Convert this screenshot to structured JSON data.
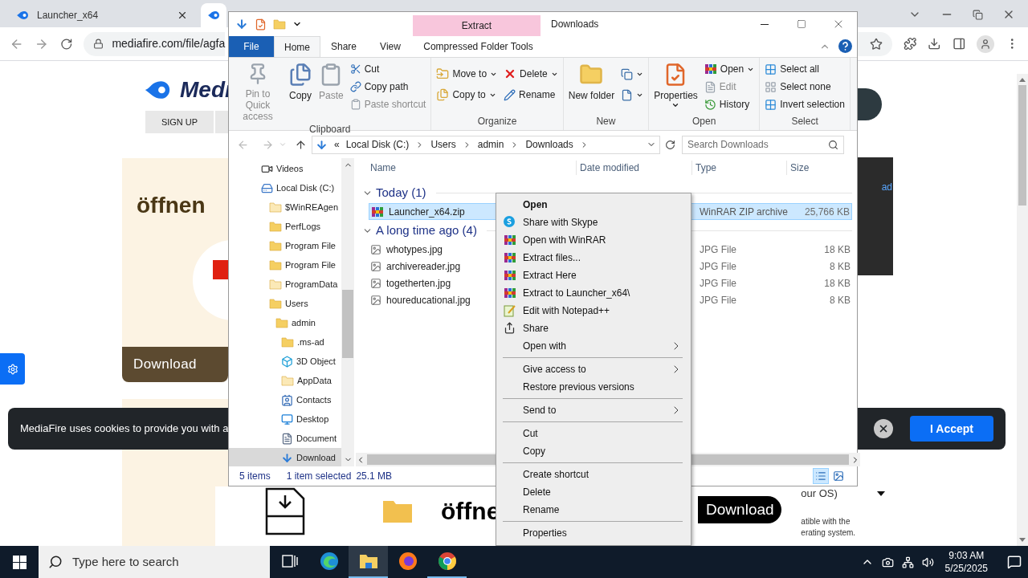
{
  "browser": {
    "tabs": [
      {
        "title": "Launcher_x64",
        "selected": false
      }
    ],
    "url": "mediafire.com/file/agfa",
    "page": {
      "logo_text": "Medi",
      "sign_up": "SIGN UP",
      "ad_heading": "öffnen",
      "ad_button": "Download",
      "cookie_text": "MediaFire uses cookies to provide you with a",
      "accept_button": "I Accept",
      "side_link": "ad",
      "bottom_heading": "öffne",
      "bottom_button": "Download",
      "os_select": "our OS)",
      "compat_lines": [
        "atible with the",
        "erating system."
      ]
    }
  },
  "explorer": {
    "title": "Downloads",
    "context_tab": "Extract",
    "ribbon_tabs": [
      {
        "label": "File",
        "kind": "file",
        "selected": false
      },
      {
        "label": "Home",
        "kind": "tab",
        "selected": true
      },
      {
        "label": "Share",
        "kind": "tab",
        "selected": false
      },
      {
        "label": "View",
        "kind": "tab",
        "selected": false
      },
      {
        "label": "Compressed Folder Tools",
        "kind": "contextual",
        "selected": false
      }
    ],
    "ribbon_groups": [
      {
        "title": "Clipboard",
        "columns": [
          {
            "kind": "large",
            "items": [
              {
                "label": "Pin to Quick access",
                "disabled": true,
                "dropdown": false
              }
            ]
          },
          {
            "kind": "large",
            "items": [
              {
                "label": "Copy",
                "disabled": false,
                "dropdown": false
              }
            ]
          },
          {
            "kind": "large",
            "items": [
              {
                "label": "Paste",
                "disabled": true,
                "dropdown": false
              }
            ]
          },
          {
            "kind": "small",
            "items": [
              {
                "label": "Cut",
                "disabled": false,
                "dropdown": false
              },
              {
                "label": "Copy path",
                "disabled": false,
                "dropdown": false
              },
              {
                "label": "Paste shortcut",
                "disabled": true,
                "dropdown": false
              }
            ]
          }
        ]
      },
      {
        "title": "Organize",
        "columns": [
          {
            "kind": "small",
            "items": [
              {
                "label": "Move to",
                "disabled": false,
                "dropdown": true
              },
              {
                "label": "Copy to",
                "disabled": false,
                "dropdown": true
              }
            ]
          },
          {
            "kind": "small",
            "items": [
              {
                "label": "Delete",
                "disabled": false,
                "dropdown": true
              },
              {
                "label": "Rename",
                "disabled": false,
                "dropdown": false
              }
            ]
          }
        ]
      },
      {
        "title": "New",
        "columns": [
          {
            "kind": "large",
            "items": [
              {
                "label": "New folder",
                "disabled": false,
                "dropdown": false
              }
            ]
          },
          {
            "kind": "small",
            "items": [
              {
                "disabled": false,
                "dropdown": true
              },
              {
                "disabled": false,
                "dropdown": true
              }
            ]
          }
        ]
      },
      {
        "title": "Open",
        "columns": [
          {
            "kind": "large",
            "items": [
              {
                "label": "Properties",
                "disabled": false,
                "dropdown": true
              }
            ]
          },
          {
            "kind": "small",
            "items": [
              {
                "label": "Open",
                "disabled": false,
                "dropdown": true
              },
              {
                "label": "Edit",
                "disabled": true,
                "dropdown": false
              },
              {
                "label": "History",
                "disabled": false,
                "dropdown": false
              }
            ]
          }
        ]
      },
      {
        "title": "Select",
        "columns": [
          {
            "kind": "small",
            "items": [
              {
                "label": "Select all",
                "disabled": false,
                "dropdown": false
              },
              {
                "label": "Select none",
                "disabled": false,
                "dropdown": false
              },
              {
                "label": "Invert selection",
                "disabled": false,
                "dropdown": false
              }
            ]
          }
        ]
      }
    ],
    "address": {
      "overflow": "«",
      "crumbs": [
        "Local Disk (C:)",
        "Users",
        "admin",
        "Downloads"
      ]
    },
    "search_placeholder": "Search Downloads",
    "nav": [
      {
        "label": "Videos",
        "kind": "videos",
        "selected": false
      },
      {
        "label": "Local Disk (C:)",
        "kind": "drive",
        "selected": false,
        "children": [
          {
            "label": "$WinREAgen",
            "kind": "folder-light",
            "selected": false
          },
          {
            "label": "PerfLogs",
            "kind": "folder",
            "selected": false
          },
          {
            "label": "Program File",
            "kind": "folder",
            "selected": false
          },
          {
            "label": "Program File",
            "kind": "folder",
            "selected": false
          },
          {
            "label": "ProgramData",
            "kind": "folder-light",
            "selected": false
          },
          {
            "label": "Users",
            "kind": "folder",
            "selected": false,
            "children": [
              {
                "label": "admin",
                "kind": "folder",
                "selected": false,
                "children": [
                  {
                    "label": ".ms-ad",
                    "kind": "folder",
                    "selected": false
                  },
                  {
                    "label": "3D Object",
                    "kind": "cube",
                    "selected": false
                  },
                  {
                    "label": "AppData",
                    "kind": "folder-light",
                    "selected": false
                  },
                  {
                    "label": "Contacts",
                    "kind": "contacts",
                    "selected": false
                  },
                  {
                    "label": "Desktop",
                    "kind": "desktop",
                    "selected": false
                  },
                  {
                    "label": "Document",
                    "kind": "documents",
                    "selected": false
                  },
                  {
                    "label": "Download",
                    "kind": "downloads",
                    "selected": true
                  }
                ]
              }
            ]
          }
        ]
      }
    ],
    "columns": [
      "Name",
      "Date modified",
      "Type",
      "Size"
    ],
    "groups": [
      {
        "title": "Today (1)",
        "expanded": true,
        "files": [
          {
            "name": "Launcher_x64.zip",
            "kind": "archive",
            "type": "WinRAR ZIP archive",
            "size": "25,766 KB",
            "selected": true
          }
        ]
      },
      {
        "title": "A long time ago (4)",
        "expanded": true,
        "files": [
          {
            "name": "whotypes.jpg",
            "kind": "image",
            "type": "JPG File",
            "size": "18 KB",
            "selected": false
          },
          {
            "name": "archivereader.jpg",
            "kind": "image",
            "type": "JPG File",
            "size": "8 KB",
            "selected": false
          },
          {
            "name": "togetherten.jpg",
            "kind": "image",
            "type": "JPG File",
            "size": "18 KB",
            "selected": false
          },
          {
            "name": "houreducational.jpg",
            "kind": "image",
            "type": "JPG File",
            "size": "8 KB",
            "selected": false
          }
        ]
      }
    ],
    "status": {
      "count": "5 items",
      "selection": "1 item selected",
      "selection_size": "25.1 MB"
    },
    "views": [
      {
        "kind": "details",
        "selected": true
      },
      {
        "kind": "large-icons",
        "selected": false
      }
    ]
  },
  "context_menu": {
    "groups": [
      [
        {
          "label": "Open",
          "default": true,
          "submenu": false
        },
        {
          "label": "Share with Skype",
          "default": false,
          "submenu": false
        },
        {
          "label": "Open with WinRAR",
          "default": false,
          "submenu": false
        },
        {
          "label": "Extract files...",
          "default": false,
          "submenu": false
        },
        {
          "label": "Extract Here",
          "default": false,
          "submenu": false
        },
        {
          "label": "Extract to Launcher_x64\\",
          "default": false,
          "submenu": false
        },
        {
          "label": "Edit with Notepad++",
          "default": false,
          "submenu": false
        },
        {
          "label": "Share",
          "default": false,
          "submenu": false
        },
        {
          "label": "Open with",
          "default": false,
          "submenu": true
        }
      ],
      [
        {
          "label": "Give access to",
          "default": false,
          "submenu": true
        },
        {
          "label": "Restore previous versions",
          "default": false,
          "submenu": false
        }
      ],
      [
        {
          "label": "Send to",
          "default": false,
          "submenu": true
        }
      ],
      [
        {
          "label": "Cut",
          "default": false,
          "submenu": false
        },
        {
          "label": "Copy",
          "default": false,
          "submenu": false
        }
      ],
      [
        {
          "label": "Create shortcut",
          "default": false,
          "submenu": false
        },
        {
          "label": "Delete",
          "default": false,
          "submenu": false
        },
        {
          "label": "Rename",
          "default": false,
          "submenu": false
        }
      ],
      [
        {
          "label": "Properties",
          "default": false,
          "submenu": false
        }
      ]
    ]
  },
  "taskbar": {
    "search_placeholder": "Type here to search",
    "apps": [
      {
        "kind": "taskview",
        "selected": false,
        "running": false
      },
      {
        "kind": "edge",
        "selected": false,
        "running": false
      },
      {
        "kind": "explorer",
        "selected": true,
        "running": true
      },
      {
        "kind": "firefox",
        "selected": false,
        "running": false
      },
      {
        "kind": "chrome",
        "selected": false,
        "running": true
      }
    ],
    "time": "9:03 AM",
    "date": "5/25/2025"
  }
}
